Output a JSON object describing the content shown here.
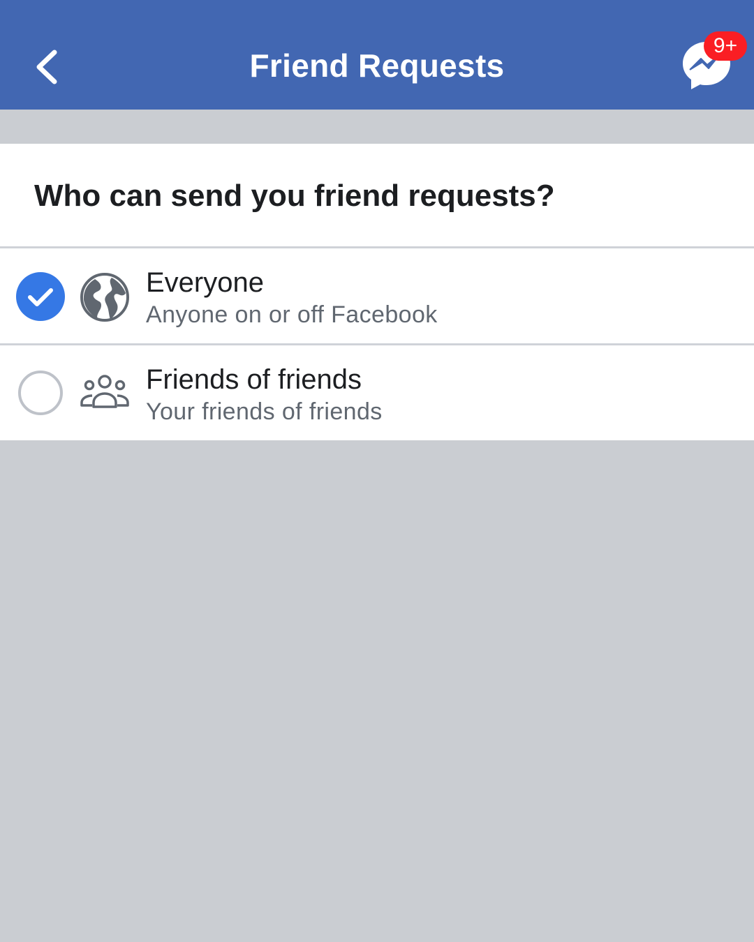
{
  "header": {
    "title": "Friend Requests",
    "back_icon": "chevron-left-icon",
    "messenger_icon": "messenger-icon",
    "messenger_badge": "9+",
    "bar_color": "#4267b2",
    "badge_color": "#fa1e24"
  },
  "question": "Who can send you friend requests?",
  "options": [
    {
      "title": "Everyone",
      "subtitle": "Anyone on or off Facebook",
      "icon": "globe-icon",
      "selected": true
    },
    {
      "title": "Friends of friends",
      "subtitle": "Your friends of friends",
      "icon": "group-icon",
      "selected": false
    }
  ],
  "colors": {
    "selected_radio": "#3578e5",
    "background": "#cacdd2"
  }
}
